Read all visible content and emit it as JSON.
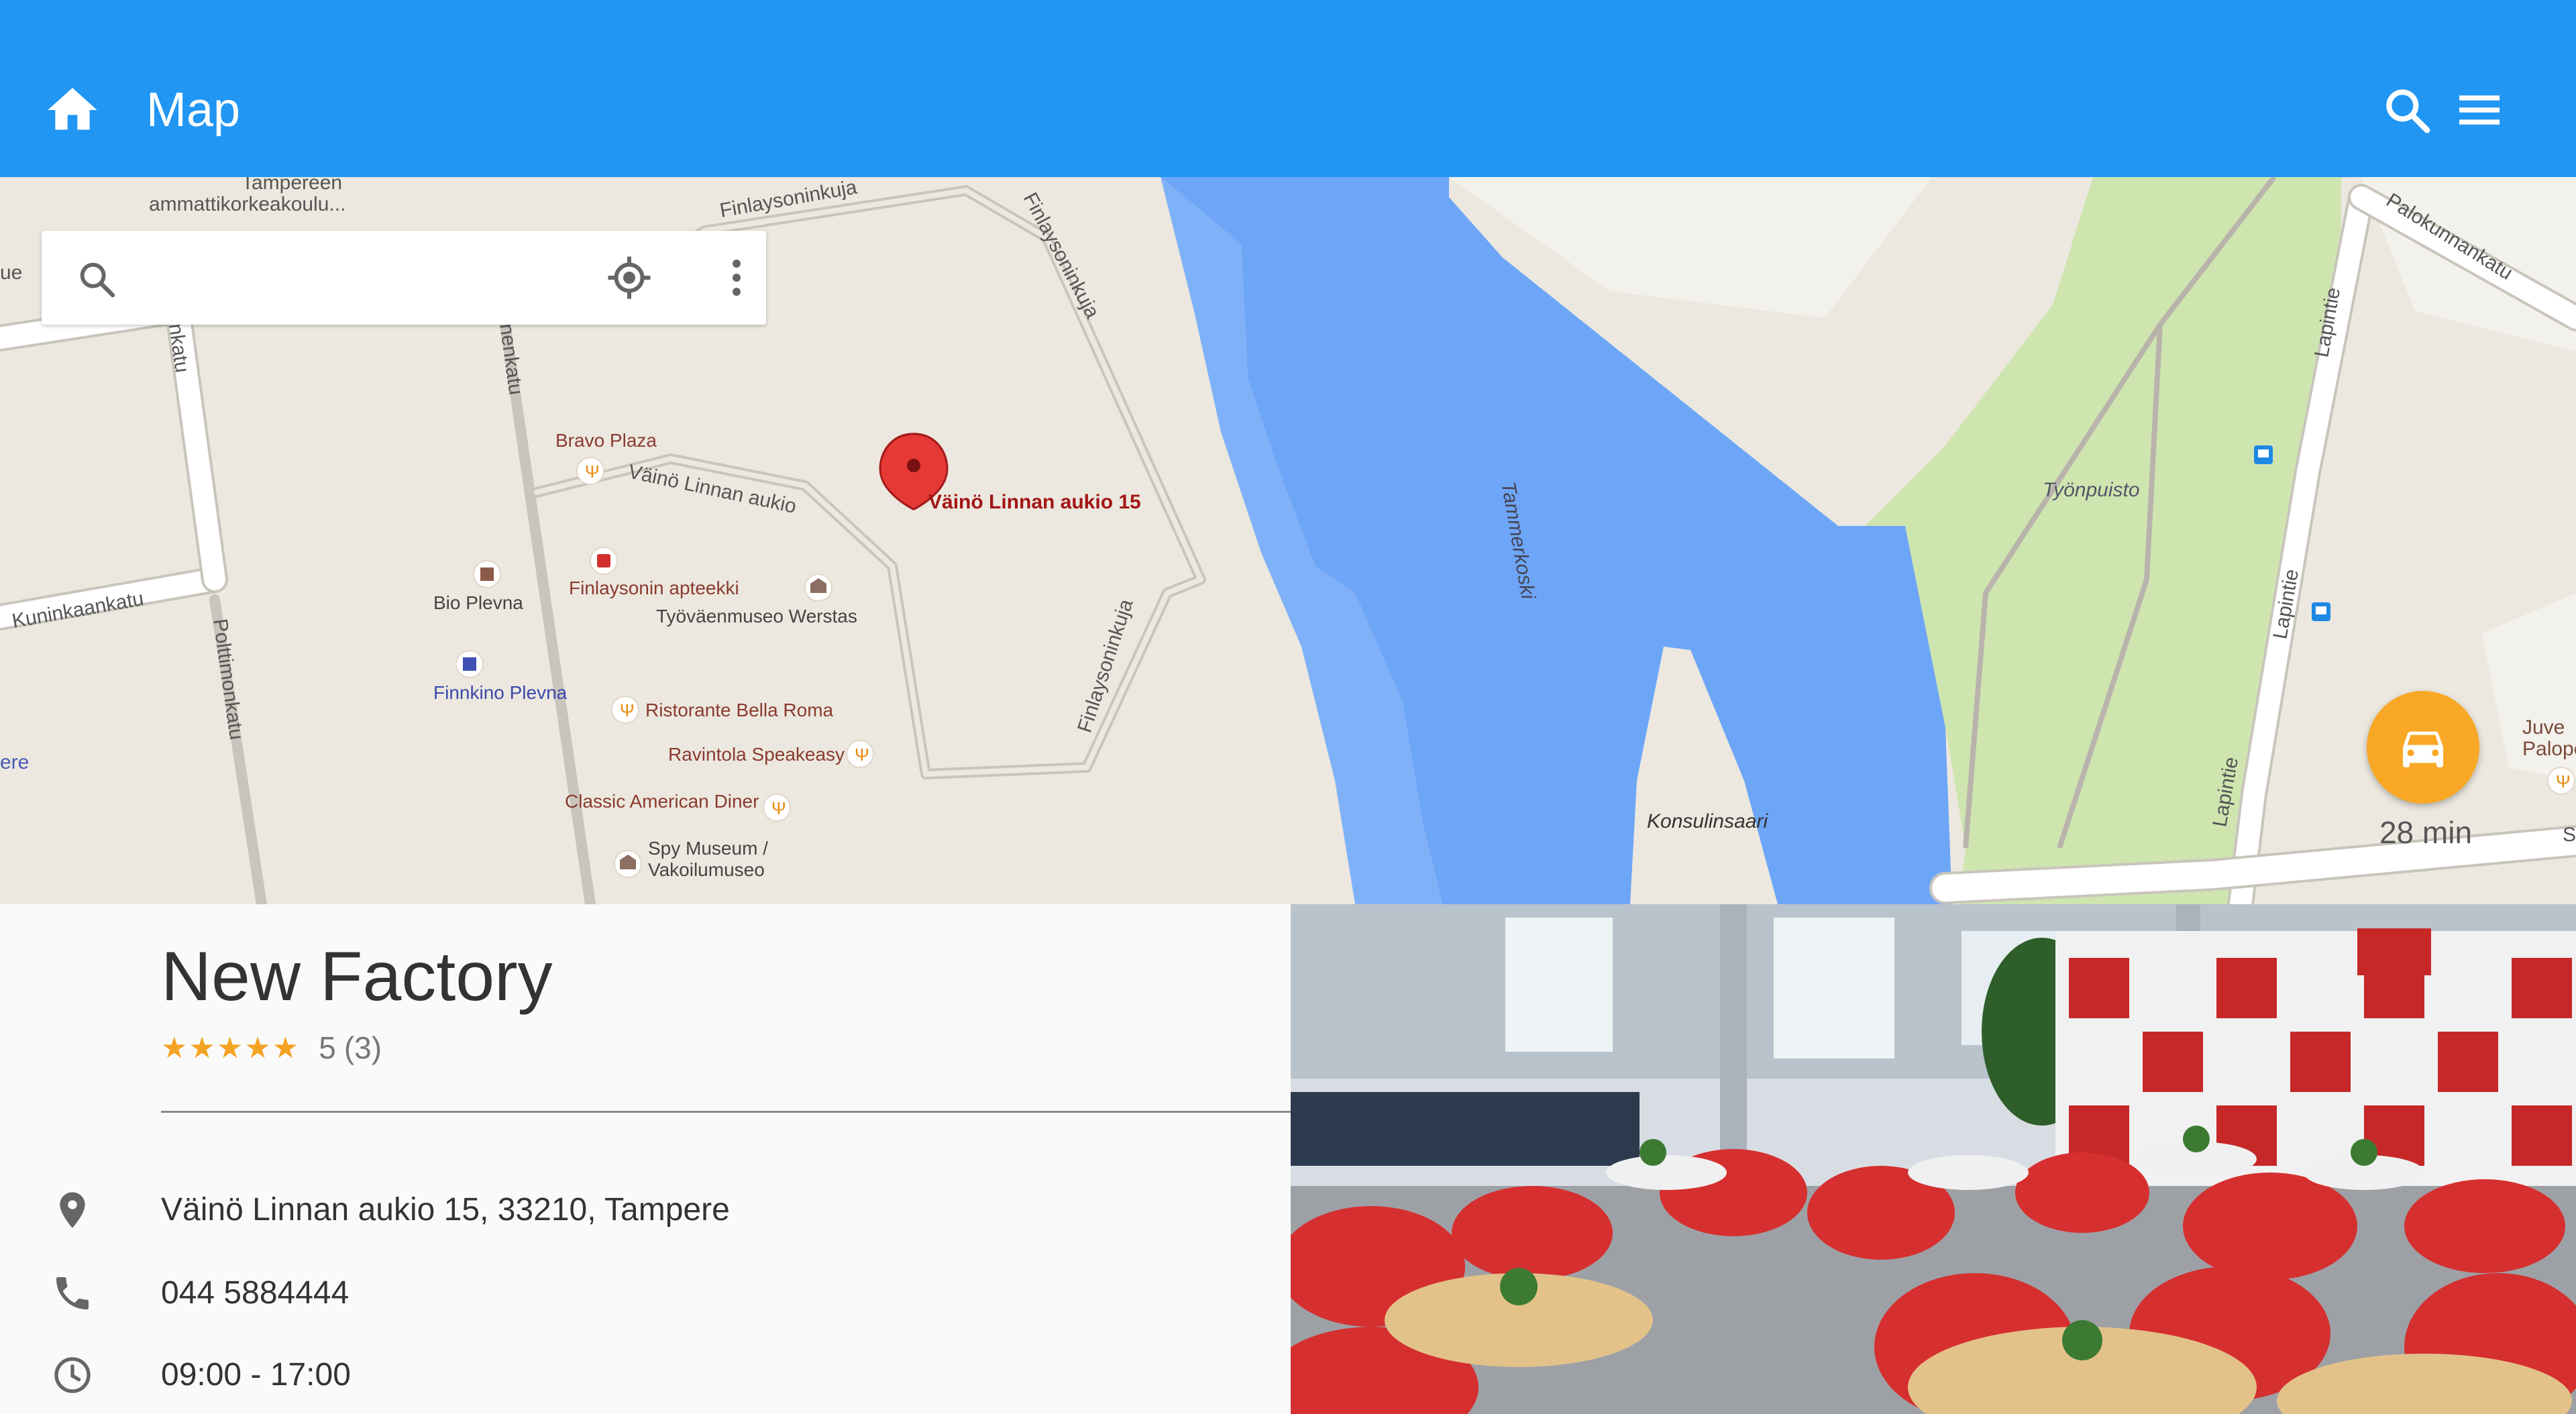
{
  "app_bar": {
    "title": "Map",
    "home_icon": "home-icon",
    "search_icon": "search-icon",
    "menu_icon": "menu-icon",
    "color": "#2196f3"
  },
  "map": {
    "search_placeholder": "",
    "search_icon": "search-icon",
    "locate_icon": "my-location-icon",
    "more_icon": "more-vert-icon",
    "marker_label": "Väinö Linnan aukio 15",
    "streets": {
      "finlaysoninkuja_top": "Finlaysoninkuja",
      "finlaysoninkuja_right": "Finlaysoninkuja",
      "finlaysoninkuja_bottom": "Finlaysoninkuja",
      "vaino_linnan_aukio": "Väinö Linnan aukio",
      "kuninkaankatu": "Kuninkaankatu",
      "puuvillatehtaankatu": "nenkatu",
      "left_street": "nkatu",
      "polttimonkatu": "Polttimonkatu",
      "palokunnankatu": "Palokunnankatu",
      "lapintie_top": "Lapintie",
      "lapintie_mid": "Lapintie",
      "lapintie_bottom": "Lapintie",
      "tammerkoski": "Tammerkoski",
      "tyonpuisto": "Työnpuisto",
      "konsulinsaari": "Konsulinsaari"
    },
    "edge_labels": {
      "left_ue": "ue",
      "left_ere": "ere",
      "right_juve": "Juve",
      "right_palope": "Palope",
      "right_s": "S",
      "tamk_1": "Tampereen",
      "tamk_2": "ammattikorkeakoulu..."
    },
    "pois": {
      "bravo_plaza": "Bravo Plaza",
      "finlaysonin_apteekki": "Finlaysonin apteekki",
      "bio_plevna": "Bio Plevna",
      "tyovaenmuseo": "Työväenmuseo Werstas",
      "finnkino_plevna": "Finnkino Plevna",
      "ristorante": "Ristorante Bella Roma",
      "speakeasy": "Ravintola Speakeasy",
      "classic_diner": "Classic American Diner",
      "spy_museum_1": "Spy Museum /",
      "spy_museum_2": "Vakoilumuseo"
    },
    "drive": {
      "icon": "car-icon",
      "time": "28 min",
      "color": "#f9a825"
    },
    "colors": {
      "land": "#ece8df",
      "water": "#6ea6f7",
      "park": "#cfe5b0",
      "road": "#ffffff",
      "road_border": "#c9c5bc"
    }
  },
  "place": {
    "name": "New Factory",
    "rating_stars": "★★★★★",
    "rating": "5",
    "review_count": "(3)",
    "address": "Väinö Linnan aukio 15, 33210, Tampere",
    "phone": "044 5884444",
    "hours": "09:00 - 17:00",
    "icons": {
      "address": "place-icon",
      "phone": "phone-icon",
      "hours": "clock-icon"
    },
    "star_color": "#f4a323"
  }
}
